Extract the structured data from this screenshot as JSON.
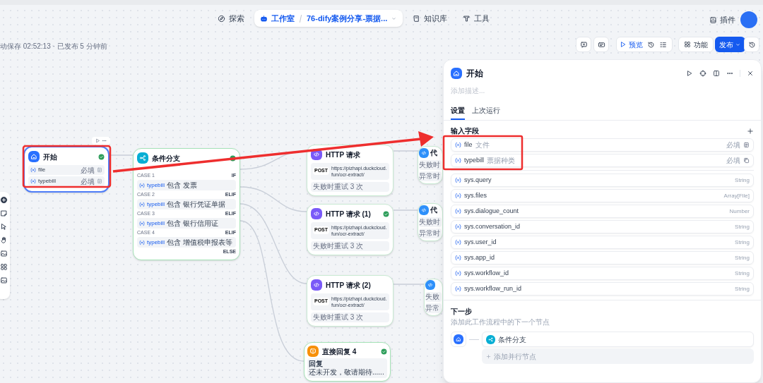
{
  "nav": {
    "items": [
      {
        "label": "探索",
        "selected": false
      },
      {
        "label": "工作室",
        "selected": true,
        "crumb": "76-dify案例分享-票据..."
      },
      {
        "label": "知识库",
        "selected": false
      },
      {
        "label": "工具",
        "selected": false
      }
    ],
    "plugins": "插件"
  },
  "toolbar": {
    "status": "动保存 02:52:13 · 已发布 5 分钟前",
    "preview": "预览",
    "features": "功能",
    "publish": "发布"
  },
  "nodes": [
    {
      "kind": "start",
      "title": "开始",
      "ok": true,
      "fields": [
        {
          "name": "file",
          "tag": "必填"
        },
        {
          "name": "typebill",
          "tag": "必填"
        }
      ]
    },
    {
      "kind": "if_else",
      "title": "条件分支",
      "ok": true,
      "cases": [
        {
          "label": "CASE 1",
          "branch": "IF",
          "var": "typebill",
          "op": "包含",
          "value": "发票"
        },
        {
          "label": "CASE 2",
          "branch": "ELIF",
          "var": "typebill",
          "op": "包含",
          "value": "银行凭证单据"
        },
        {
          "label": "CASE 3",
          "branch": "ELIF",
          "var": "typebill",
          "op": "包含",
          "value": "银行信用证"
        },
        {
          "label": "CASE 4",
          "branch": "ELIF",
          "var": "typebill",
          "op": "包含",
          "value": "增值税申报表等"
        }
      ],
      "else": "ELSE"
    },
    {
      "kind": "http",
      "title": "HTTP 请求",
      "ok": false,
      "method": "POST",
      "url": "https://pizhapi.duckcloud.fun/ocr-extract/",
      "retry": "失败时重试 3 次"
    },
    {
      "kind": "code",
      "title": "代",
      "rows": [
        "失败时",
        "异常时"
      ]
    },
    {
      "kind": "http",
      "title": "HTTP 请求 (1)",
      "ok": true,
      "method": "POST",
      "url": "https://pizhapi.duckcloud.fun/ocr-extract/",
      "retry": "失败时重试 3 次"
    },
    {
      "kind": "code",
      "title": "代",
      "rows": [
        "失败时",
        "异常时"
      ]
    },
    {
      "kind": "http",
      "title": "HTTP 请求 (2)",
      "ok": false,
      "method": "POST",
      "url": "https://pizhapi.duckcloud.fun/ocr-extract/",
      "retry": "失败时重试 3 次"
    },
    {
      "kind": "code",
      "rows": [
        "失败",
        "异常"
      ]
    },
    {
      "kind": "answer",
      "title": "直接回复 4",
      "ok": true,
      "label": "回复",
      "text": "还未开发，敬请期待......"
    }
  ],
  "panel": {
    "title": "开始",
    "description_placeholder": "添加描述...",
    "tabs": [
      {
        "label": "设置",
        "selected": true
      },
      {
        "label": "上次运行",
        "selected": false
      }
    ],
    "section": "输入字段",
    "inputs": [
      {
        "name": "file",
        "label": "文件",
        "tag": "必填"
      },
      {
        "name": "typebill",
        "label": "票据种类",
        "tag": "必填"
      }
    ],
    "variables": [
      {
        "name": "sys.query",
        "type": "String"
      },
      {
        "name": "sys.files",
        "type": "Array[File]"
      },
      {
        "name": "sys.dialogue_count",
        "type": "Number"
      },
      {
        "name": "sys.conversation_id",
        "type": "String"
      },
      {
        "name": "sys.user_id",
        "type": "String"
      },
      {
        "name": "sys.app_id",
        "type": "String"
      },
      {
        "name": "sys.workflow_id",
        "type": "String"
      },
      {
        "name": "sys.workflow_run_id",
        "type": "String"
      }
    ],
    "next": {
      "title": "下一步",
      "subtitle": "添加此工作流程中的下一个节点",
      "node": "条件分支",
      "add": "添加并行节点"
    }
  }
}
